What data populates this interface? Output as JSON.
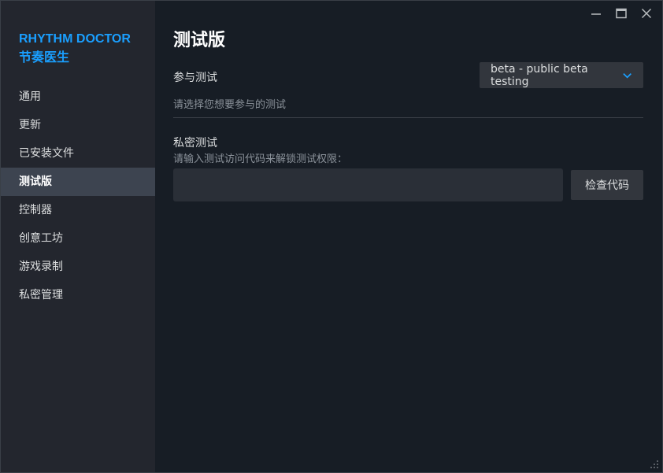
{
  "app": {
    "title_en": "RHYTHM DOCTOR",
    "title_cn": "节奏医生"
  },
  "sidebar": {
    "items": [
      {
        "label": "通用"
      },
      {
        "label": "更新"
      },
      {
        "label": "已安装文件"
      },
      {
        "label": "测试版",
        "active": true
      },
      {
        "label": "控制器"
      },
      {
        "label": "创意工坊"
      },
      {
        "label": "游戏录制"
      },
      {
        "label": "私密管理"
      }
    ]
  },
  "main": {
    "title": "测试版",
    "participate": {
      "label": "参与测试",
      "selected": "beta - public beta testing",
      "description": "请选择您想要参与的测试"
    },
    "private": {
      "label": "私密测试",
      "description": "请输入测试访问代码来解锁测试权限：",
      "input_value": "",
      "button_label": "检查代码"
    }
  },
  "colors": {
    "accent": "#1a9fff",
    "background": "#171d25",
    "sidebar": "#23262e",
    "active_item": "#3d4450"
  }
}
